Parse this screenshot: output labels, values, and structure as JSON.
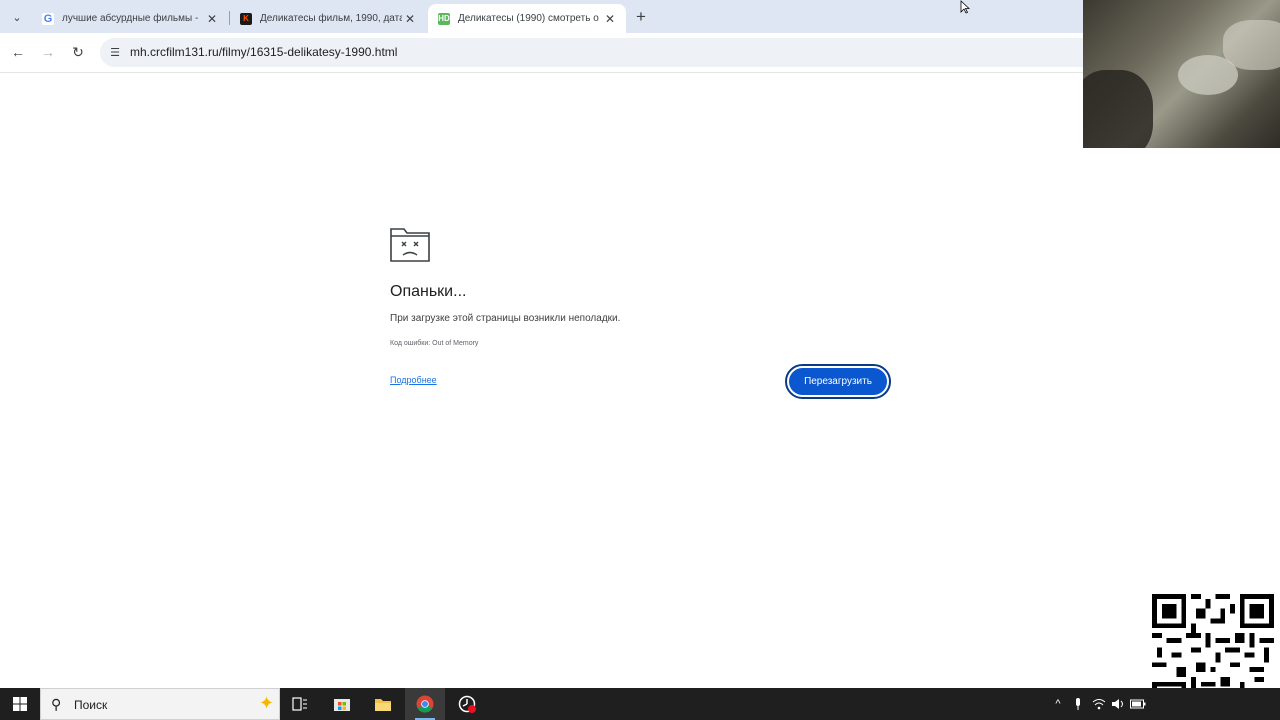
{
  "browser": {
    "tabs": [
      {
        "title": "лучшие абсурдные фильмы -",
        "favicon": "google-favicon",
        "active": false
      },
      {
        "title": "Деликатесы фильм, 1990, дата",
        "favicon": "kinopoisk-favicon",
        "active": false
      },
      {
        "title": "Деликатесы (1990) смотреть о",
        "favicon": "hd-favicon",
        "active": true
      }
    ],
    "new_tab_label": "+",
    "url": "mh.crcfilm131.ru/filmy/16315-delikatesy-1990.html"
  },
  "error_page": {
    "heading": "Опаньки...",
    "description": "При загрузке этой страницы возникли неполадки.",
    "error_code": "Код ошибки: Out of Memory",
    "learn_more": "Подробнее",
    "reload_button": "Перезагрузить",
    "icon": "sad-tab-icon"
  },
  "taskbar": {
    "search_placeholder": "Поиск",
    "pinned": [
      "task-view-icon",
      "store-icon",
      "file-explorer-icon",
      "chrome-icon",
      "recorder-icon"
    ],
    "tray": [
      "chevron-up-icon",
      "microphone-icon",
      "wifi-icon",
      "volume-icon",
      "battery-icon"
    ]
  },
  "colors": {
    "tabstrip": "#dfe6f3",
    "accent": "#0b57d0",
    "link": "#1a73e8",
    "taskbar": "#1f1f1f"
  }
}
